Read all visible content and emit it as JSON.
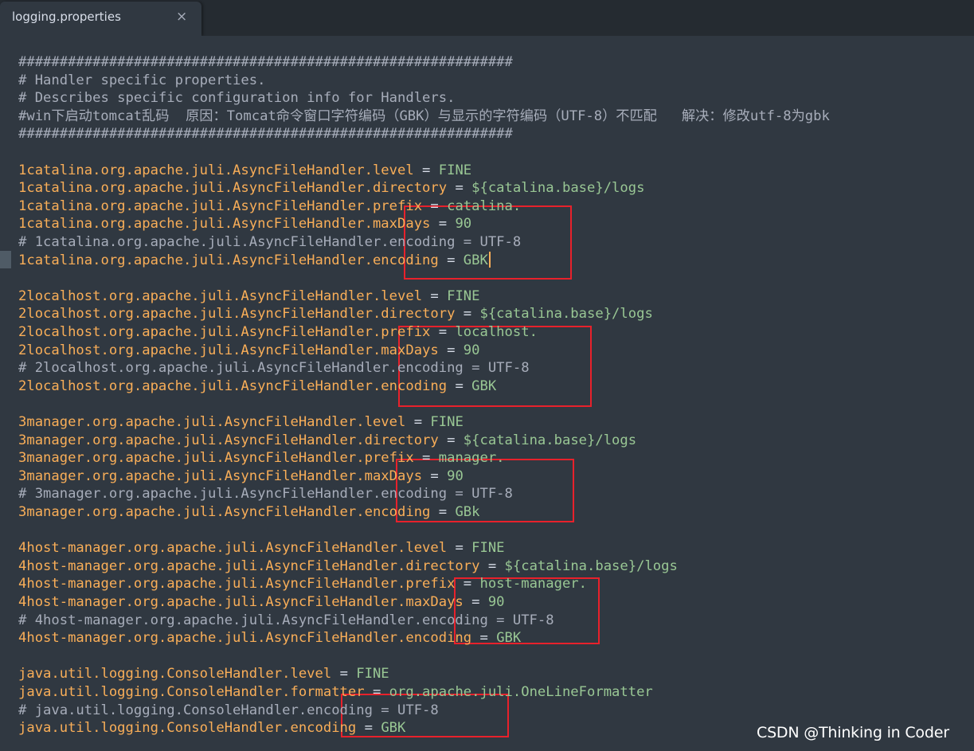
{
  "tab": {
    "title": "logging.properties",
    "close": "×"
  },
  "lines": [
    {
      "type": "comment",
      "text": "############################################################"
    },
    {
      "type": "comment",
      "text": "# Handler specific properties."
    },
    {
      "type": "comment",
      "text": "# Describes specific configuration info for Handlers."
    },
    {
      "type": "comment",
      "text": "#win下启动tomcat乱码  原因：Tomcat命令窗口字符编码（GBK）与显示的字符编码（UTF-8）不匹配   解决：修改utf-8为gbk"
    },
    {
      "type": "comment",
      "text": "############################################################"
    },
    {
      "type": "blank"
    },
    {
      "type": "prop",
      "key": "1catalina.org.apache.juli.AsyncFileHandler.level",
      "value": "FINE"
    },
    {
      "type": "prop",
      "key": "1catalina.org.apache.juli.AsyncFileHandler.directory",
      "value": "${catalina.base}/logs"
    },
    {
      "type": "prop",
      "key": "1catalina.org.apache.juli.AsyncFileHandler.prefix",
      "value": "catalina."
    },
    {
      "type": "prop",
      "key": "1catalina.org.apache.juli.AsyncFileHandler.maxDays",
      "value": "90"
    },
    {
      "type": "comment",
      "text": "# 1catalina.org.apache.juli.AsyncFileHandler.encoding = UTF-8"
    },
    {
      "type": "prop",
      "key": "1catalina.org.apache.juli.AsyncFileHandler.encoding",
      "value": "GBK",
      "caret": true
    },
    {
      "type": "blank"
    },
    {
      "type": "prop",
      "key": "2localhost.org.apache.juli.AsyncFileHandler.level",
      "value": "FINE"
    },
    {
      "type": "prop",
      "key": "2localhost.org.apache.juli.AsyncFileHandler.directory",
      "value": "${catalina.base}/logs"
    },
    {
      "type": "prop",
      "key": "2localhost.org.apache.juli.AsyncFileHandler.prefix",
      "value": "localhost."
    },
    {
      "type": "prop",
      "key": "2localhost.org.apache.juli.AsyncFileHandler.maxDays",
      "value": "90"
    },
    {
      "type": "comment",
      "text": "# 2localhost.org.apache.juli.AsyncFileHandler.encoding = UTF-8"
    },
    {
      "type": "prop",
      "key": "2localhost.org.apache.juli.AsyncFileHandler.encoding",
      "value": "GBK"
    },
    {
      "type": "blank"
    },
    {
      "type": "prop",
      "key": "3manager.org.apache.juli.AsyncFileHandler.level",
      "value": "FINE"
    },
    {
      "type": "prop",
      "key": "3manager.org.apache.juli.AsyncFileHandler.directory",
      "value": "${catalina.base}/logs"
    },
    {
      "type": "prop",
      "key": "3manager.org.apache.juli.AsyncFileHandler.prefix",
      "value": "manager."
    },
    {
      "type": "prop",
      "key": "3manager.org.apache.juli.AsyncFileHandler.maxDays",
      "value": "90"
    },
    {
      "type": "comment",
      "text": "# 3manager.org.apache.juli.AsyncFileHandler.encoding = UTF-8"
    },
    {
      "type": "prop",
      "key": "3manager.org.apache.juli.AsyncFileHandler.encoding",
      "value": "GBk"
    },
    {
      "type": "blank"
    },
    {
      "type": "prop",
      "key": "4host-manager.org.apache.juli.AsyncFileHandler.level",
      "value": "FINE"
    },
    {
      "type": "prop",
      "key": "4host-manager.org.apache.juli.AsyncFileHandler.directory",
      "value": "${catalina.base}/logs"
    },
    {
      "type": "prop",
      "key": "4host-manager.org.apache.juli.AsyncFileHandler.prefix",
      "value": "host-manager."
    },
    {
      "type": "prop",
      "key": "4host-manager.org.apache.juli.AsyncFileHandler.maxDays",
      "value": "90"
    },
    {
      "type": "comment",
      "text": "# 4host-manager.org.apache.juli.AsyncFileHandler.encoding = UTF-8"
    },
    {
      "type": "prop",
      "key": "4host-manager.org.apache.juli.AsyncFileHandler.encoding",
      "value": "GBK"
    },
    {
      "type": "blank"
    },
    {
      "type": "prop",
      "key": "java.util.logging.ConsoleHandler.level",
      "value": "FINE"
    },
    {
      "type": "prop",
      "key": "java.util.logging.ConsoleHandler.formatter",
      "value": "org.apache.juli.OneLineFormatter"
    },
    {
      "type": "comment",
      "text": "# java.util.logging.ConsoleHandler.encoding = UTF-8"
    },
    {
      "type": "prop",
      "key": "java.util.logging.ConsoleHandler.encoding",
      "value": "GBK"
    }
  ],
  "watermark": "CSDN @Thinking in Coder",
  "colors": {
    "background": "#303841",
    "tabbar": "#252b31",
    "comment": "#a7adba",
    "key": "#f9ae58",
    "operator": "#d8dee9",
    "value": "#99c794",
    "annotation": "#e8212b"
  }
}
